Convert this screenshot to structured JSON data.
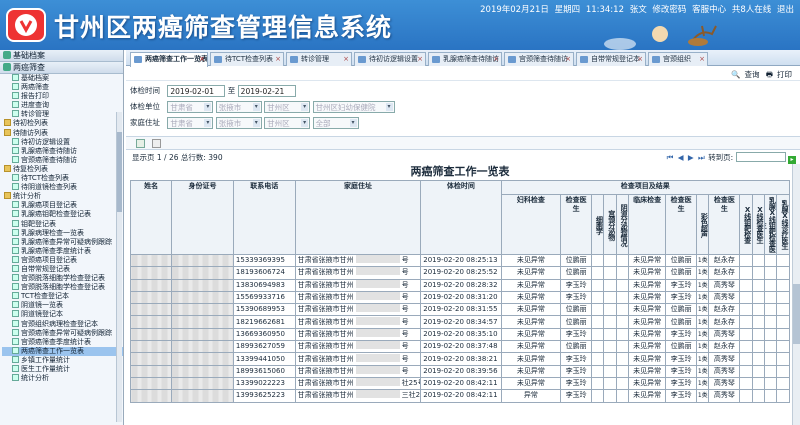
{
  "header": {
    "title": "甘州区两癌筛查管理信息系统",
    "info": [
      "2019年02月21日",
      "星期四",
      "11:34:12",
      "张文",
      "修改密码",
      "客服中心",
      "共8人在线",
      "退出"
    ]
  },
  "sidebar": {
    "top_sections": [
      {
        "label": "基础档案"
      },
      {
        "label": "两癌筛查"
      }
    ],
    "items": [
      {
        "label": "基础档案",
        "type": "doc"
      },
      {
        "label": "两癌筛查",
        "type": "doc"
      },
      {
        "label": "报告打印",
        "type": "doc"
      },
      {
        "label": "进度查询",
        "type": "doc"
      },
      {
        "label": "转诊管理",
        "type": "doc"
      },
      {
        "label": "待初检列表",
        "type": "folder"
      },
      {
        "label": "待随访列表",
        "type": "folder"
      },
      {
        "label": "待初访逻辑设置",
        "type": "doc"
      },
      {
        "label": "乳腺癌筛查待随访",
        "type": "doc"
      },
      {
        "label": "宫颈癌筛查待随访",
        "type": "doc"
      },
      {
        "label": "待复检列表",
        "type": "folder"
      },
      {
        "label": "待TCT检查列表",
        "type": "doc"
      },
      {
        "label": "待阴道镜检查列表",
        "type": "doc"
      },
      {
        "label": "统计分析",
        "type": "folder"
      },
      {
        "label": "乳腺癌项目登记表",
        "type": "doc"
      },
      {
        "label": "乳腺癌钼靶检查登记表",
        "type": "doc"
      },
      {
        "label": "钼靶登记表",
        "type": "doc"
      },
      {
        "label": "乳腺病理检查一览表",
        "type": "doc"
      },
      {
        "label": "乳腺癌筛查异常可疑病例跟踪",
        "type": "doc"
      },
      {
        "label": "乳腺癌筛查季度统计表",
        "type": "doc"
      },
      {
        "label": "宫颈癌项目登记表",
        "type": "doc"
      },
      {
        "label": "自带常规登记表",
        "type": "doc"
      },
      {
        "label": "宫颈脱落细胞学检查登记表",
        "type": "doc"
      },
      {
        "label": "宫颈脱落细胞学检查登记表",
        "type": "doc"
      },
      {
        "label": "TCT检查登记本",
        "type": "doc"
      },
      {
        "label": "阴道镜一览表",
        "type": "doc"
      },
      {
        "label": "阴道镜登记本",
        "type": "doc"
      },
      {
        "label": "宫颈组织病理检查登记本",
        "type": "doc"
      },
      {
        "label": "宫颈癌筛查异常可疑病例跟踪",
        "type": "doc"
      },
      {
        "label": "宫颈癌筛查季度统计表",
        "type": "doc"
      },
      {
        "label": "两癌筛查工作一览表",
        "type": "doc",
        "selected": true
      },
      {
        "label": "乡镇工作量统计",
        "type": "doc"
      },
      {
        "label": "医生工作量统计",
        "type": "doc"
      },
      {
        "label": "统计分析",
        "type": "doc"
      }
    ]
  },
  "tabs": [
    {
      "label": "两癌筛查工作一览表",
      "active": true
    },
    {
      "label": "待TCT检查列表"
    },
    {
      "label": "转诊管理"
    },
    {
      "label": "待初访逻辑设置"
    },
    {
      "label": "乳腺癌筛查待随访"
    },
    {
      "label": "宫颈筛查待随访"
    },
    {
      "label": "自带常规登记本"
    },
    {
      "label": "宫颈组织"
    }
  ],
  "toolbar": {
    "query": "查询",
    "print": "打印"
  },
  "form": {
    "time_label": "体检时间",
    "date_from": "2019-02-01",
    "to_label": "至",
    "date_to": "2019-02-21",
    "unit_label": "体检单位",
    "unit_selects": [
      "甘肃省",
      "张掖市",
      "甘州区",
      "甘州区妇幼保健院"
    ],
    "home_label": "家庭住址",
    "home_selects": [
      "甘肃省",
      "张掖市",
      "甘州区",
      "全部"
    ]
  },
  "pager": {
    "summary": "显示页 1 / 26 总行数: 390",
    "goto_label": "转到页:"
  },
  "report": {
    "title": "两癌筛查工作一览表",
    "headers": {
      "name": "姓名",
      "id": "身份证号",
      "phone": "联系电话",
      "address": "家庭住址",
      "time": "体检时间",
      "group": "检查项目及结果",
      "gyn": "妇科检查",
      "gyn_doc": "检查医生",
      "v1": "细胞学",
      "v2": "宫颈分泌物",
      "v3": "阴道分泌物情况",
      "clinic": "临床检查",
      "clinic_doc": "检查医生",
      "v4": "彩色超声",
      "v5": "检查医生",
      "v6": "X线钼靶检查",
      "v7": "X线检查医生",
      "v8": "乳腺X线钼靶检查医生",
      "v9": "乳腺X线诊疗医生"
    },
    "rows": [
      {
        "phone": "15339369395",
        "addr_start": "甘肃省张掖市甘州",
        "addr_end": "号",
        "time": "2019-02-20 08:25:13",
        "gyn": "未见异常",
        "gyn_doc": "位鹏丽",
        "clinic": "未见异常",
        "clinic_doc": "位鹏丽",
        "res": "1类",
        "doc": "赵永存"
      },
      {
        "phone": "18193606724",
        "addr_start": "甘肃省张掖市甘州",
        "addr_end": "号",
        "time": "2019-02-20 08:25:52",
        "gyn": "未见异常",
        "gyn_doc": "位鹏丽",
        "clinic": "未见异常",
        "clinic_doc": "位鹏丽",
        "res": "1类",
        "doc": "赵永存"
      },
      {
        "phone": "13830694983",
        "addr_start": "甘肃省张掖市甘州",
        "addr_end": "号",
        "time": "2019-02-20 08:28:32",
        "gyn": "未见异常",
        "gyn_doc": "李玉玲",
        "clinic": "未见异常",
        "clinic_doc": "李玉玲",
        "res": "1类",
        "doc": "高秀琴"
      },
      {
        "phone": "15569933716",
        "addr_start": "甘肃省张掖市甘州",
        "addr_end": "号",
        "time": "2019-02-20 08:31:20",
        "gyn": "未见异常",
        "gyn_doc": "李玉玲",
        "clinic": "未见异常",
        "clinic_doc": "李玉玲",
        "res": "1类",
        "doc": "高秀琴"
      },
      {
        "phone": "15390689953",
        "addr_start": "甘肃省张掖市甘州",
        "addr_end": "号",
        "time": "2019-02-20 08:31:55",
        "gyn": "未见异常",
        "gyn_doc": "位鹏丽",
        "clinic": "未见异常",
        "clinic_doc": "位鹏丽",
        "res": "1类",
        "doc": "赵永存"
      },
      {
        "phone": "18219662681",
        "addr_start": "甘肃省张掖市甘州",
        "addr_end": "号",
        "time": "2019-02-20 08:34:57",
        "gyn": "未见异常",
        "gyn_doc": "位鹏丽",
        "clinic": "未见异常",
        "clinic_doc": "位鹏丽",
        "res": "1类",
        "doc": "赵永存"
      },
      {
        "phone": "13669360950",
        "addr_start": "甘肃省张掖市甘州",
        "addr_end": "号",
        "time": "2019-02-20 08:35:10",
        "gyn": "未见异常",
        "gyn_doc": "李玉玲",
        "clinic": "未见异常",
        "clinic_doc": "李玉玲",
        "res": "1类",
        "doc": "高秀琴"
      },
      {
        "phone": "18993627059",
        "addr_start": "甘肃省张掖市甘州",
        "addr_end": "号",
        "time": "2019-02-20 08:37:48",
        "gyn": "未见异常",
        "gyn_doc": "位鹏丽",
        "clinic": "未见异常",
        "clinic_doc": "位鹏丽",
        "res": "1类",
        "doc": "赵永存"
      },
      {
        "phone": "13399441050",
        "addr_start": "甘肃省张掖市甘州",
        "addr_end": "号",
        "time": "2019-02-20 08:38:21",
        "gyn": "未见异常",
        "gyn_doc": "李玉玲",
        "clinic": "未见异常",
        "clinic_doc": "李玉玲",
        "res": "1类",
        "doc": "高秀琴"
      },
      {
        "phone": "18993615060",
        "addr_start": "甘肃省张掖市甘州",
        "addr_end": "号",
        "time": "2019-02-20 08:39:56",
        "gyn": "未见异常",
        "gyn_doc": "李玉玲",
        "clinic": "未见异常",
        "clinic_doc": "李玉玲",
        "res": "1类",
        "doc": "高秀琴"
      },
      {
        "phone": "13399022223",
        "addr_start": "甘肃省张掖市甘州",
        "addr_end": "社25号",
        "time": "2019-02-20 08:42:11",
        "gyn": "未见异常",
        "gyn_doc": "李玉玲",
        "clinic": "未见异常",
        "clinic_doc": "李玉玲",
        "res": "1类",
        "doc": "高秀琴"
      },
      {
        "phone": "13993625223",
        "addr_start": "甘肃省张掖市甘州",
        "addr_end": "三社28号",
        "time": "2019-02-20 08:42:11",
        "gyn": "异常",
        "gyn_doc": "李玉玲",
        "clinic": "未见异常",
        "clinic_doc": "李玉玲",
        "res": "1类",
        "doc": "高秀琴"
      }
    ]
  },
  "colors": {
    "header_blue": "#2a74c3",
    "logo_red": "#e33",
    "selected": "#9bc4ee"
  }
}
